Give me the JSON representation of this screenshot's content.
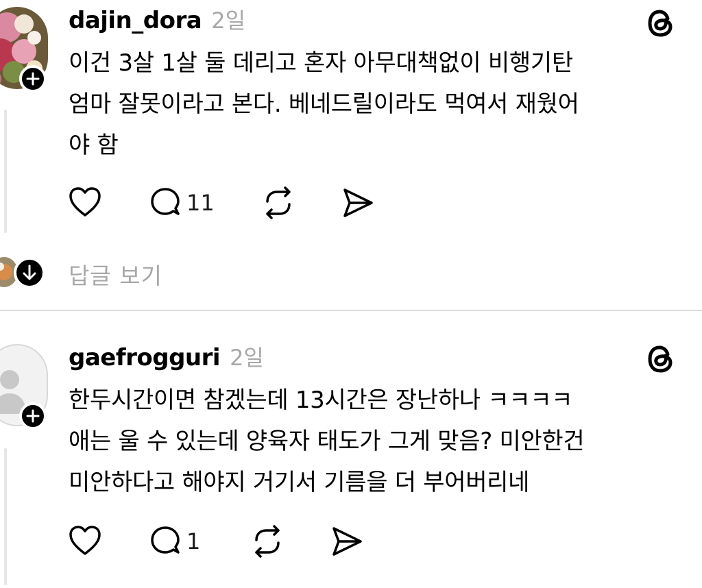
{
  "posts": [
    {
      "username": "dajin_dora",
      "time": "2일",
      "lines": [
        "이건 3살 1살 둘 데리고  혼자 아무대책없이 비행기탄",
        "엄마 잘못이라고 본다. 베네드릴이라도 먹여서 재웠어",
        "야 함"
      ],
      "reply_count": "11",
      "view_replies_label": "답글 보기"
    },
    {
      "username": "gaefrogguri",
      "time": "2일",
      "lines": [
        "한두시간이면 참겠는데 13시간은 장난하나 ㅋㅋㅋㅋ",
        "애는 울 수 있는데 양육자 태도가 그게 맞음? 미안한건",
        "미안하다고 해야지 거기서 기름을 더 부어버리네"
      ],
      "reply_count": "1"
    }
  ],
  "icons": {
    "threads": "threads-logo-icon",
    "like": "heart-icon",
    "comment": "comment-bubble-icon",
    "repost": "repost-icon",
    "share": "send-icon",
    "follow": "plus-icon",
    "expand": "arrow-down-icon"
  },
  "colors": {
    "muted": "#a8a8a8",
    "divider": "#dcdcdc"
  }
}
